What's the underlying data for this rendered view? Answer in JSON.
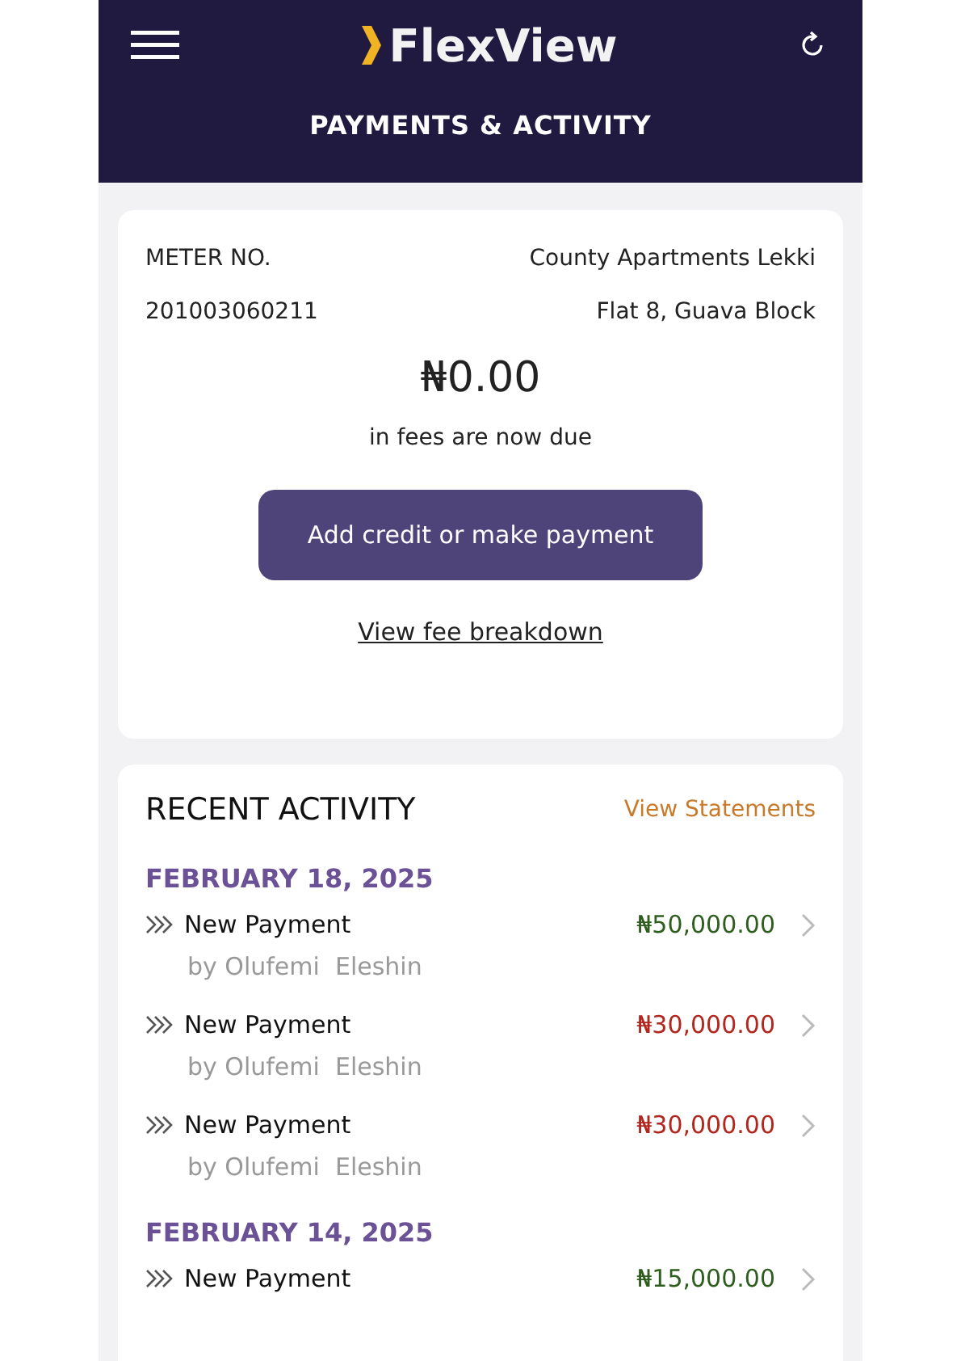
{
  "header": {
    "app_name": "FlexView",
    "title": "PAYMENTS & ACTIVITY"
  },
  "account": {
    "meter_label": "METER NO.",
    "meter_number": "201003060211",
    "property": "County Apartments Lekki",
    "unit": "Flat 8, Guava Block",
    "amount_due": "₦0.00",
    "due_note": "in fees are now due",
    "pay_button": "Add credit or make payment",
    "breakdown_link": "View fee breakdown"
  },
  "activity": {
    "title": "RECENT ACTIVITY",
    "statements_link": "View Statements",
    "groups": [
      {
        "date": "FEBRUARY 18, 2025",
        "items": [
          {
            "title": "New Payment",
            "by": "by Olufemi  Eleshin",
            "amount": "₦50,000.00",
            "color": "#2e5e1e"
          },
          {
            "title": "New Payment",
            "by": "by Olufemi  Eleshin",
            "amount": "₦30,000.00",
            "color": "#b3261e"
          },
          {
            "title": "New Payment",
            "by": "by Olufemi  Eleshin",
            "amount": "₦30,000.00",
            "color": "#b3261e"
          }
        ]
      },
      {
        "date": "FEBRUARY 14, 2025",
        "items": [
          {
            "title": "New Payment",
            "amount": "₦15,000.00",
            "color": "#2e5e1e"
          }
        ]
      }
    ]
  }
}
